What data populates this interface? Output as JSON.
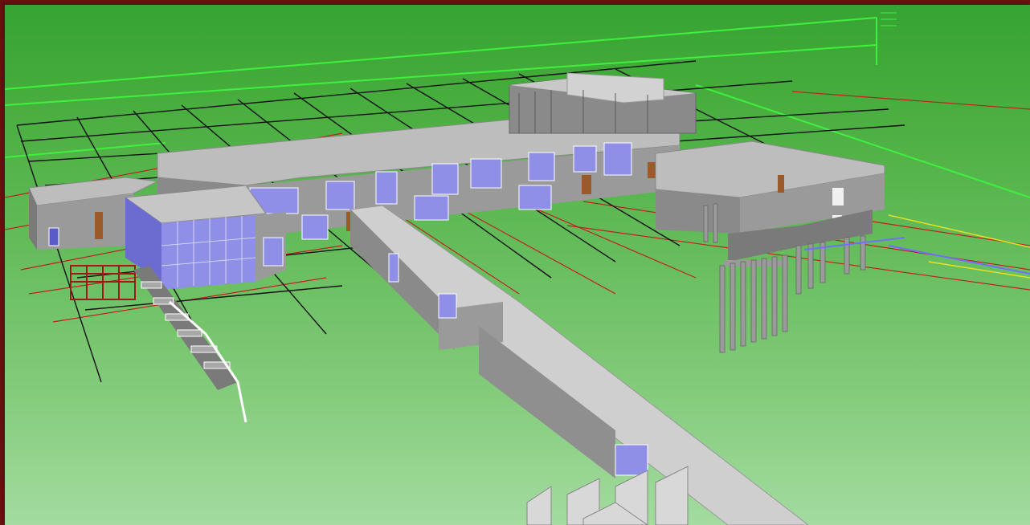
{
  "app": {
    "view_type": "3d-model-viewport"
  },
  "colors": {
    "frame": "#6b0e0e",
    "sky_top": "#36a332",
    "sky_bottom": "#a4dba0",
    "grid_black": "#111111",
    "grid_red": "#c02020",
    "grid_green": "#3ff03f",
    "roof": "#bdbdbd",
    "wall": "#9a9a9a",
    "wall_dark": "#7a7a7a",
    "glass": "#8f8fe8",
    "glass_dark": "#5a5ac8",
    "door": "#9a5a2a"
  },
  "scene": {
    "objects": [
      "main-building",
      "glass-atrium",
      "bridge-walkway",
      "east-wing-on-piles",
      "stairway",
      "red-scaffold",
      "structural-grid"
    ]
  }
}
